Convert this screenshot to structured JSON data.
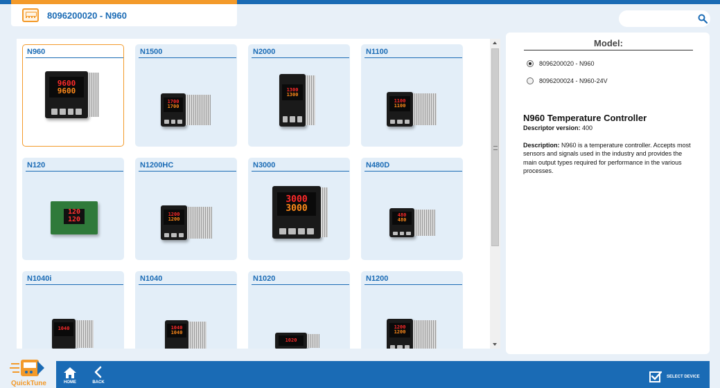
{
  "header": {
    "title": "8096200020 - N960",
    "title_icon": "controller-device-icon",
    "search": {
      "placeholder": "",
      "value": "",
      "icon": "search-icon"
    }
  },
  "devices": [
    {
      "label": "N960",
      "selected": true,
      "display": [
        "9600",
        "9600"
      ]
    },
    {
      "label": "N1500",
      "selected": false,
      "display": [
        "1700",
        "1700"
      ]
    },
    {
      "label": "N2000",
      "selected": false,
      "display": [
        "1300",
        "1300"
      ]
    },
    {
      "label": "N1100",
      "selected": false,
      "display": [
        "1100",
        "1100"
      ]
    },
    {
      "label": "N120",
      "selected": false,
      "display": [
        "120",
        "120"
      ]
    },
    {
      "label": "N1200HC",
      "selected": false,
      "display": [
        "1200",
        "1200"
      ]
    },
    {
      "label": "N3000",
      "selected": false,
      "display": [
        "3000",
        "3000"
      ]
    },
    {
      "label": "N480D",
      "selected": false,
      "display": [
        "480",
        "480"
      ]
    },
    {
      "label": "N1040i",
      "selected": false,
      "display": [
        "1040",
        ""
      ]
    },
    {
      "label": "N1040",
      "selected": false,
      "display": [
        "1040",
        "1040"
      ]
    },
    {
      "label": "N1020",
      "selected": false,
      "display": [
        "1020",
        ""
      ]
    },
    {
      "label": "N1200",
      "selected": false,
      "display": [
        "1200",
        "1200"
      ]
    }
  ],
  "detail": {
    "model_heading": "Model:",
    "models": [
      {
        "label": "8096200020 - N960",
        "checked": true
      },
      {
        "label": "8096200024 - N960-24V",
        "checked": false
      }
    ],
    "title": "N960 Temperature Controller",
    "descriptor_label": "Descriptor version:",
    "descriptor_value": "400",
    "description_label": "Description:",
    "description_text": "N960 is a temperature controller. Accepts most sensors and signals used in the industry and provides the main output types required for performance in the various processes."
  },
  "footer": {
    "logo_text": "QuickTune",
    "home_label": "HOME",
    "back_label": "BACK",
    "select_device_label": "SELECT DEVICE"
  },
  "colors": {
    "brand_blue": "#1a6bb5",
    "accent_orange": "#f39a2a",
    "background": "#e8f0f8",
    "card_bg": "#e3eef8"
  }
}
